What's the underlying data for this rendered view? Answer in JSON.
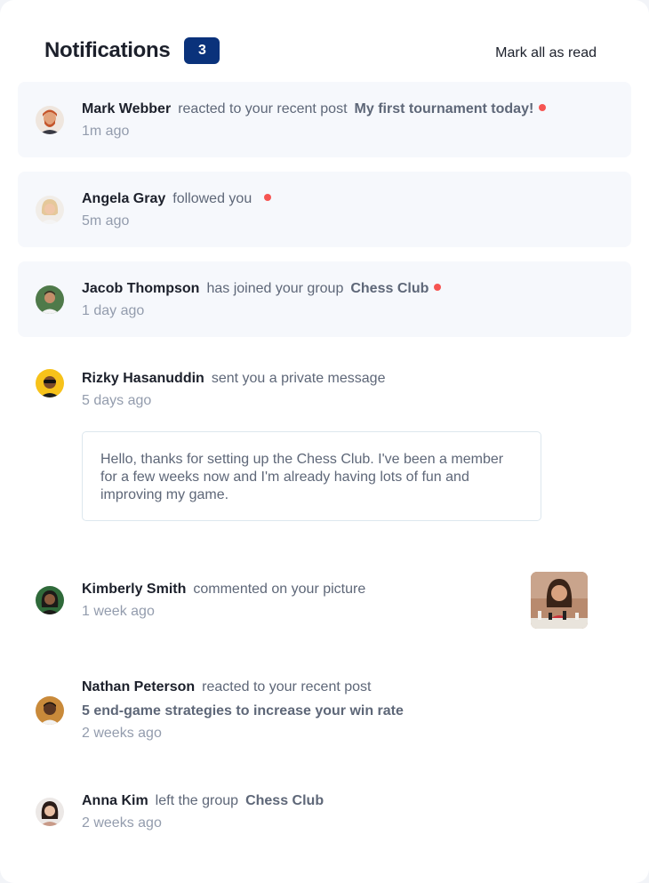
{
  "header": {
    "title": "Notifications",
    "unread_count": "3",
    "mark_all_label": "Mark all as read"
  },
  "notifications": [
    {
      "name": "Mark Webber",
      "action": "reacted to your recent post",
      "target": "My first tournament today!",
      "time": "1m ago",
      "unread": true,
      "avatar": "mark-webber-avatar"
    },
    {
      "name": "Angela Gray",
      "action": "followed you",
      "target": "",
      "time": "5m ago",
      "unread": true,
      "avatar": "angela-gray-avatar"
    },
    {
      "name": "Jacob Thompson",
      "action": "has joined your group",
      "target": "Chess Club",
      "time": "1 day ago",
      "unread": true,
      "avatar": "jacob-thompson-avatar"
    },
    {
      "name": "Rizky Hasanuddin",
      "action": "sent you a private message",
      "target": "",
      "time": "5 days ago",
      "unread": false,
      "avatar": "rizky-hasanuddin-avatar",
      "message": "Hello, thanks for setting up the Chess Club. I've been a member for a few weeks now and I'm already having lots of fun and improving my game."
    },
    {
      "name": "Kimberly Smith",
      "action": "commented on your picture",
      "target": "",
      "time": "1 week ago",
      "unread": false,
      "avatar": "kimberly-smith-avatar",
      "picture": "chess-picture"
    },
    {
      "name": "Nathan Peterson",
      "action": "reacted to your recent post",
      "target": "5 end-game strategies to increase your win rate",
      "time": "2 weeks ago",
      "unread": false,
      "avatar": "nathan-peterson-avatar"
    },
    {
      "name": "Anna Kim",
      "action": "left the group",
      "target": "Chess Club",
      "time": "2 weeks ago",
      "unread": false,
      "avatar": "anna-kim-avatar"
    }
  ],
  "colors": {
    "unread_dot": "#f65552",
    "badge": "#0a327b",
    "unread_bg": "#f6f8fc"
  }
}
